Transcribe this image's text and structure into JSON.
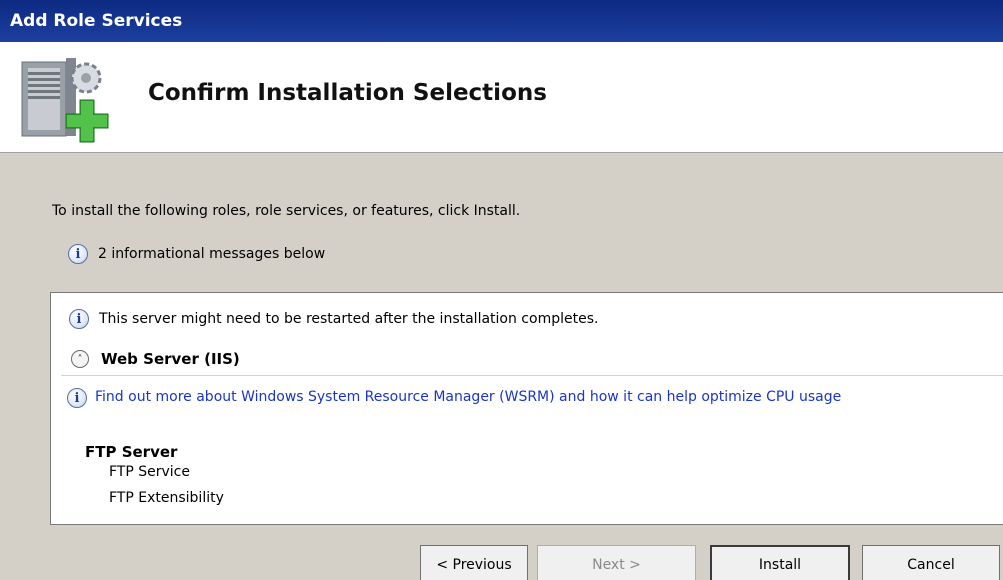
{
  "window": {
    "title": "Add Role Services"
  },
  "header": {
    "title": "Confirm Installation Selections",
    "icon": "server-add-icon"
  },
  "body": {
    "intro": "To install the following roles, role services, or features, click Install.",
    "info_count": "2 informational messages below"
  },
  "list": {
    "restart_note": "This server might need to be restarted after the installation completes.",
    "section": {
      "title": "Web Server (IIS)",
      "link": "Find out more about Windows System Resource Manager (WSRM) and how it can help optimize CPU usage",
      "feature_group": "FTP Server",
      "feature_items": [
        "FTP Service",
        "FTP Extensibility"
      ]
    }
  },
  "buttons": {
    "previous": "< Previous",
    "next": "Next >",
    "install": "Install",
    "cancel": "Cancel"
  },
  "colors": {
    "titlebar": "#0d2a82",
    "link": "#1a35c8",
    "dialog_bg": "#d4d0c8"
  }
}
